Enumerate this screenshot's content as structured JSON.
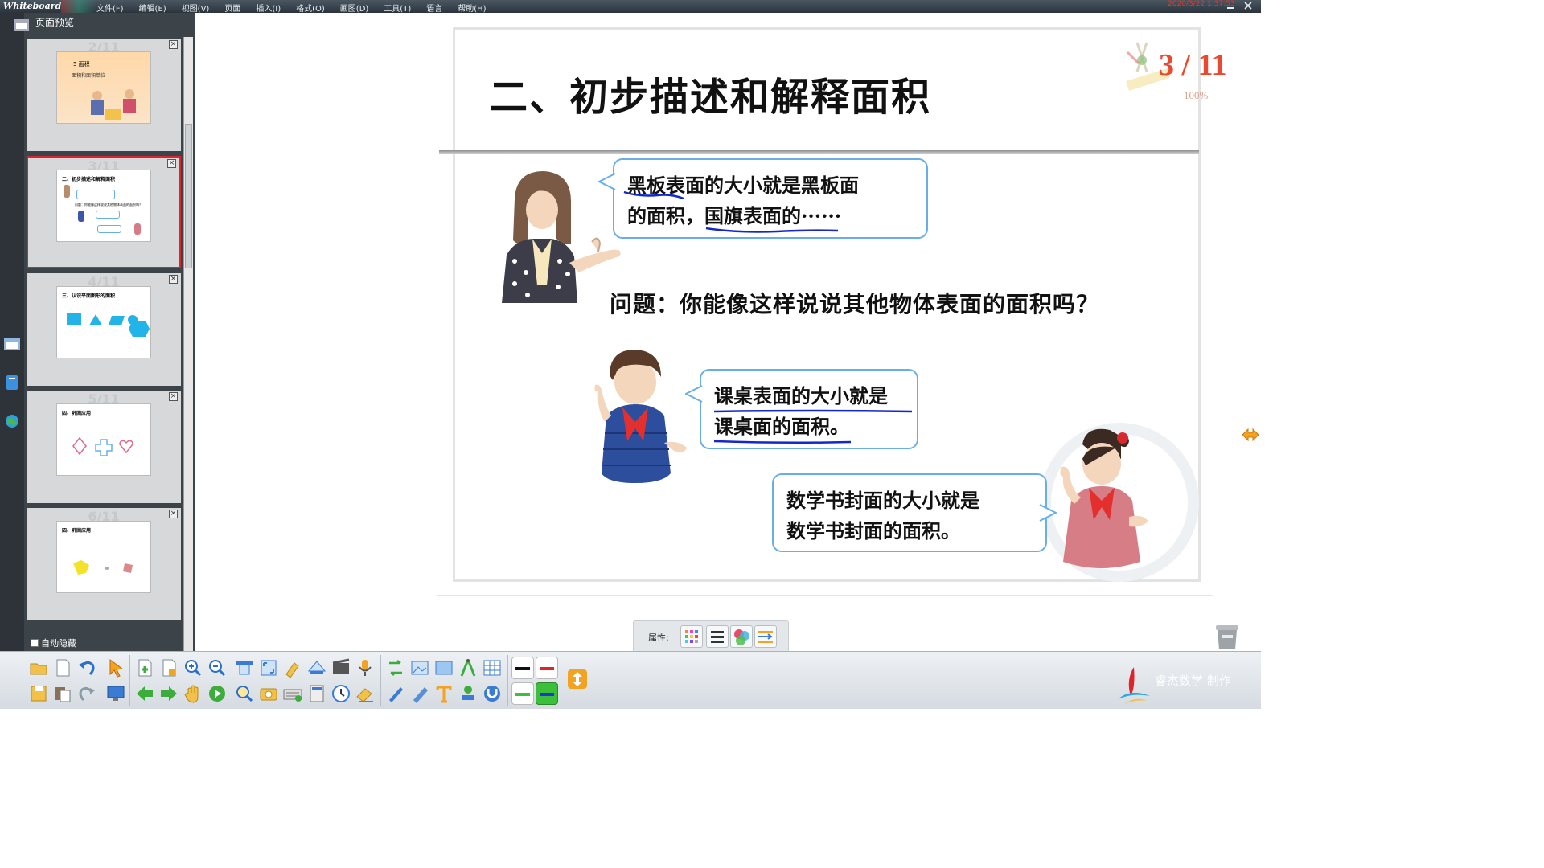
{
  "app": {
    "title": "Whiteboard",
    "menus": [
      "文件(F)",
      "编辑(E)",
      "视图(V)",
      "页面",
      "插入(I)",
      "格式(O)",
      "画图(D)",
      "工具(T)",
      "语言",
      "帮助(H)"
    ],
    "datetime": "2020/3/22 1:37:53"
  },
  "preview": {
    "title": "页面预览",
    "autohide_label": "自动隐藏",
    "thumbs": [
      {
        "num": "2/11",
        "active": false,
        "line1": "5 面积",
        "line2": "面积和面积单位"
      },
      {
        "num": "3/11",
        "active": true,
        "line1": "二、初步描述和解释面积",
        "line2": "问题：你能像这样说说其他物体表面的面积吗？"
      },
      {
        "num": "4/11",
        "active": false,
        "line1": "三、认识平面图形的面积",
        "line2": ""
      },
      {
        "num": "5/11",
        "active": false,
        "line1": "四、巩固应用",
        "line2": ""
      },
      {
        "num": "6/11",
        "active": false,
        "line1": "四、巩固应用",
        "line2": ""
      }
    ]
  },
  "slide": {
    "title": "二、初步描述和解释面积",
    "page_indicator": "3 / 11",
    "zoom": "100%",
    "bubble1": {
      "line1": "黑板表面的大小就是黑板面",
      "line2": "的面积，国旗表面的······"
    },
    "question": "问题：你能像这样说说其他物体表面的面积吗？",
    "bubble2": {
      "line1": "课桌表面的大小就是",
      "line2": "课桌面的面积。"
    },
    "bubble3": {
      "line1": "数学书封面的大小就是",
      "line2": "数学书封面的面积。"
    }
  },
  "properties": {
    "label": "属性:"
  },
  "brand": {
    "text": "睿杰数学 制作"
  },
  "colors": {
    "accent_red": "#e8492f",
    "bubble_border": "#6aaee6",
    "underline_blue": "#1428c8",
    "active_thumb_border": "#e0222a"
  },
  "icons": {
    "toolbar": [
      "open-icon",
      "new-page-icon",
      "undo-icon",
      "select-arrow-icon",
      "add-page-icon",
      "blank-page-icon",
      "zoom-in-icon",
      "zoom-out-icon",
      "screen-icon",
      "fullscreen-icon",
      "highlighter-icon",
      "scanner-icon",
      "video-icon",
      "mic-icon",
      "swap-icon",
      "image-icon",
      "picture-icon",
      "compass-icon",
      "table-icon",
      "save-icon",
      "paste-icon",
      "redo-icon",
      "monitor-icon",
      "prev-page-icon",
      "next-page-icon",
      "hand-icon",
      "play-icon",
      "magnifier-icon",
      "camera-icon",
      "keyboard-icon",
      "calculator-icon",
      "clock-icon",
      "eraser-icon",
      "pen-icon",
      "ruler-icon",
      "text-icon",
      "stamp-icon",
      "magnet-icon",
      "black-line-icon",
      "red-line-icon",
      "green-line-icon",
      "blue-line-icon",
      "resize-toolbar-icon"
    ]
  }
}
